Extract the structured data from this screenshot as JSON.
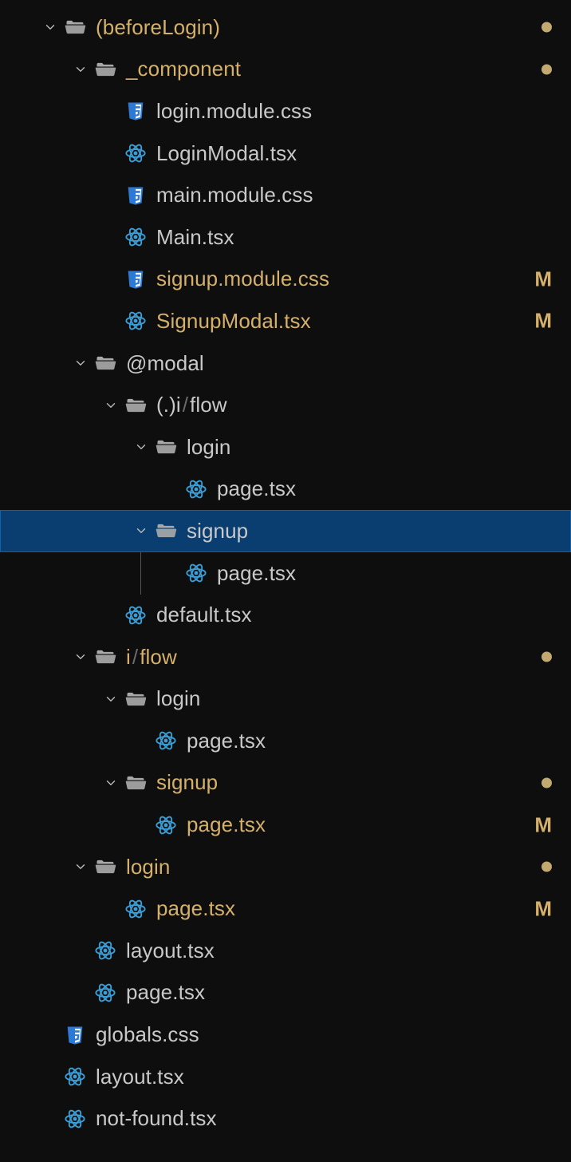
{
  "tree": [
    {
      "depth": 0,
      "kind": "folder-open",
      "chevron": "down",
      "label": "(beforeLogin)",
      "highlight": true,
      "status": "dot"
    },
    {
      "depth": 1,
      "kind": "folder-open",
      "chevron": "down",
      "label": "_component",
      "highlight": true,
      "status": "dot"
    },
    {
      "depth": 2,
      "kind": "css",
      "label": "login.module.css"
    },
    {
      "depth": 2,
      "kind": "react",
      "label": "LoginModal.tsx"
    },
    {
      "depth": 2,
      "kind": "css",
      "label": "main.module.css"
    },
    {
      "depth": 2,
      "kind": "react",
      "label": "Main.tsx"
    },
    {
      "depth": 2,
      "kind": "css",
      "label": "signup.module.css",
      "highlight": true,
      "status": "M"
    },
    {
      "depth": 2,
      "kind": "react",
      "label": "SignupModal.tsx",
      "highlight": true,
      "status": "M"
    },
    {
      "depth": 1,
      "kind": "folder-open",
      "chevron": "down",
      "label": "@modal"
    },
    {
      "depth": 2,
      "kind": "folder-open",
      "chevron": "down",
      "labelParts": [
        "(.)i",
        "flow"
      ]
    },
    {
      "depth": 3,
      "kind": "folder-open",
      "chevron": "down",
      "label": "login"
    },
    {
      "depth": 4,
      "kind": "react",
      "label": "page.tsx"
    },
    {
      "depth": 3,
      "kind": "folder-open",
      "chevron": "down",
      "label": "signup",
      "selected": true
    },
    {
      "depth": 4,
      "kind": "react",
      "label": "page.tsx",
      "guide": true
    },
    {
      "depth": 2,
      "kind": "react",
      "label": "default.tsx"
    },
    {
      "depth": 1,
      "kind": "folder-open",
      "chevron": "down",
      "labelParts": [
        "i",
        "flow"
      ],
      "highlight": true,
      "status": "dot"
    },
    {
      "depth": 2,
      "kind": "folder-open",
      "chevron": "down",
      "label": "login"
    },
    {
      "depth": 3,
      "kind": "react",
      "label": "page.tsx"
    },
    {
      "depth": 2,
      "kind": "folder-open",
      "chevron": "down",
      "label": "signup",
      "highlight": true,
      "status": "dot"
    },
    {
      "depth": 3,
      "kind": "react",
      "label": "page.tsx",
      "highlight": true,
      "status": "M"
    },
    {
      "depth": 1,
      "kind": "folder-open",
      "chevron": "down",
      "label": "login",
      "highlight": true,
      "status": "dot"
    },
    {
      "depth": 2,
      "kind": "react",
      "label": "page.tsx",
      "highlight": true,
      "status": "M"
    },
    {
      "depth": 1,
      "kind": "react",
      "label": "layout.tsx"
    },
    {
      "depth": 1,
      "kind": "react",
      "label": "page.tsx"
    },
    {
      "depth": 0,
      "kind": "css",
      "label": "globals.css"
    },
    {
      "depth": 0,
      "kind": "react",
      "label": "layout.tsx"
    },
    {
      "depth": 0,
      "kind": "react",
      "label": "not-found.tsx"
    }
  ],
  "icons": {
    "folderColor": "#a8a8a8",
    "cssColor": "#2c7ad6",
    "reactColor": "#3b9ed6"
  },
  "indent": {
    "base": 54,
    "step": 38,
    "fileExtra": 26
  }
}
